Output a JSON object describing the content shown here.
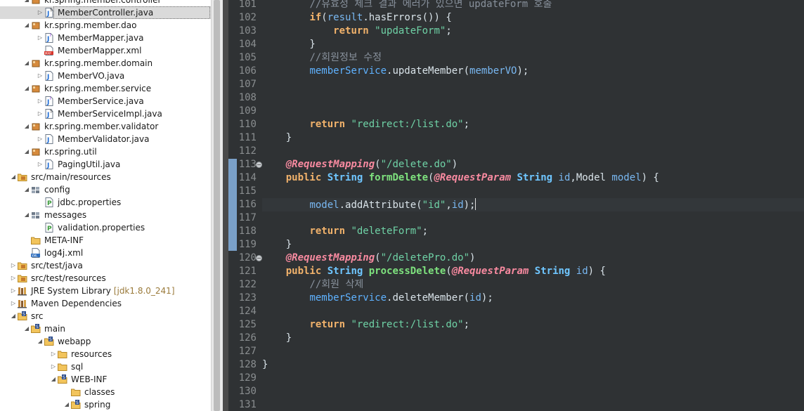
{
  "explorer": {
    "items": [
      {
        "label": "kr.spring.member.controller",
        "icon": "package-icon",
        "twisty": "expanded",
        "indent": 2,
        "selected": false
      },
      {
        "label": "MemberController.java",
        "icon": "java-class-icon",
        "twisty": "collapsed",
        "indent": 3,
        "selected": true
      },
      {
        "label": "kr.spring.member.dao",
        "icon": "package-icon",
        "twisty": "expanded",
        "indent": 2,
        "selected": false
      },
      {
        "label": "MemberMapper.java",
        "icon": "java-interface-icon",
        "twisty": "collapsed",
        "indent": 3,
        "selected": false
      },
      {
        "label": "MemberMapper.xml",
        "icon": "mybatis-xml-icon",
        "twisty": "none",
        "indent": 3,
        "selected": false
      },
      {
        "label": "kr.spring.member.domain",
        "icon": "package-icon",
        "twisty": "expanded",
        "indent": 2,
        "selected": false
      },
      {
        "label": "MemberVO.java",
        "icon": "java-file-icon",
        "twisty": "collapsed",
        "indent": 3,
        "selected": false
      },
      {
        "label": "kr.spring.member.service",
        "icon": "package-icon",
        "twisty": "expanded",
        "indent": 2,
        "selected": false
      },
      {
        "label": "MemberService.java",
        "icon": "java-interface-icon",
        "twisty": "collapsed",
        "indent": 3,
        "selected": false
      },
      {
        "label": "MemberServiceImpl.java",
        "icon": "java-class-icon",
        "twisty": "collapsed",
        "indent": 3,
        "selected": false
      },
      {
        "label": "kr.spring.member.validator",
        "icon": "package-icon",
        "twisty": "expanded",
        "indent": 2,
        "selected": false
      },
      {
        "label": "MemberValidator.java",
        "icon": "java-file-icon",
        "twisty": "collapsed",
        "indent": 3,
        "selected": false
      },
      {
        "label": "kr.spring.util",
        "icon": "package-icon",
        "twisty": "expanded",
        "indent": 2,
        "selected": false
      },
      {
        "label": "PagingUtil.java",
        "icon": "java-file-icon",
        "twisty": "collapsed",
        "indent": 3,
        "selected": false
      },
      {
        "label": "src/main/resources",
        "icon": "source-folder-icon",
        "twisty": "expanded",
        "indent": 1,
        "selected": false
      },
      {
        "label": "config",
        "icon": "resource-package-icon",
        "twisty": "expanded",
        "indent": 2,
        "selected": false
      },
      {
        "label": "jdbc.properties",
        "icon": "properties-file-icon",
        "twisty": "none",
        "indent": 3,
        "selected": false
      },
      {
        "label": "messages",
        "icon": "resource-package-icon",
        "twisty": "expanded",
        "indent": 2,
        "selected": false
      },
      {
        "label": "validation.properties",
        "icon": "properties-file-icon",
        "twisty": "none",
        "indent": 3,
        "selected": false
      },
      {
        "label": "META-INF",
        "icon": "folder-icon",
        "twisty": "none",
        "indent": 2,
        "selected": false
      },
      {
        "label": "log4j.xml",
        "icon": "xml-file-icon",
        "twisty": "none",
        "indent": 2,
        "selected": false
      },
      {
        "label": "src/test/java",
        "icon": "source-folder-icon",
        "twisty": "collapsed",
        "indent": 1,
        "selected": false
      },
      {
        "label": "src/test/resources",
        "icon": "source-folder-icon",
        "twisty": "collapsed",
        "indent": 1,
        "selected": false
      },
      {
        "label": "JRE System Library",
        "suffix": "[jdk1.8.0_241]",
        "icon": "library-icon",
        "twisty": "collapsed",
        "indent": 1,
        "selected": false
      },
      {
        "label": "Maven Dependencies",
        "icon": "library-icon",
        "twisty": "collapsed",
        "indent": 1,
        "selected": false
      },
      {
        "label": "src",
        "icon": "vcs-folder-icon",
        "twisty": "expanded",
        "indent": 1,
        "selected": false
      },
      {
        "label": "main",
        "icon": "vcs-folder-icon",
        "twisty": "expanded",
        "indent": 2,
        "selected": false
      },
      {
        "label": "webapp",
        "icon": "vcs-folder-icon",
        "twisty": "expanded",
        "indent": 3,
        "selected": false
      },
      {
        "label": "resources",
        "icon": "folder-icon",
        "twisty": "collapsed",
        "indent": 4,
        "selected": false
      },
      {
        "label": "sql",
        "icon": "folder-icon",
        "twisty": "collapsed",
        "indent": 4,
        "selected": false
      },
      {
        "label": "WEB-INF",
        "icon": "vcs-folder-icon",
        "twisty": "expanded",
        "indent": 4,
        "selected": false
      },
      {
        "label": "classes",
        "icon": "folder-icon",
        "twisty": "none",
        "indent": 5,
        "selected": false
      },
      {
        "label": "spring",
        "icon": "vcs-folder-icon",
        "twisty": "expanded",
        "indent": 5,
        "selected": false
      }
    ]
  },
  "editor": {
    "current_line": "116",
    "lines": [
      {
        "no": "101",
        "tokens": [
          [
            "pl",
            "        "
          ],
          [
            "cm",
            "//유효성 체크 결과 에러가 있으면 updateForm 호출"
          ]
        ]
      },
      {
        "no": "102",
        "tokens": [
          [
            "pl",
            "        "
          ],
          [
            "kw",
            "if"
          ],
          [
            "pl",
            "("
          ],
          [
            "var",
            "result"
          ],
          [
            "pl",
            "."
          ],
          [
            "pl",
            "hasErrors"
          ],
          [
            "pl",
            "()) {"
          ]
        ]
      },
      {
        "no": "103",
        "tokens": [
          [
            "pl",
            "            "
          ],
          [
            "kw",
            "return"
          ],
          [
            "pl",
            " "
          ],
          [
            "str",
            "\"updateForm\""
          ],
          [
            "pl",
            ";"
          ]
        ]
      },
      {
        "no": "104",
        "tokens": [
          [
            "pl",
            "        }"
          ]
        ]
      },
      {
        "no": "105",
        "tokens": [
          [
            "pl",
            "        "
          ],
          [
            "cm",
            "//회원정보 수정"
          ]
        ]
      },
      {
        "no": "106",
        "tokens": [
          [
            "pl",
            "        "
          ],
          [
            "fld",
            "memberService"
          ],
          [
            "pl",
            "."
          ],
          [
            "pl",
            "updateMember("
          ],
          [
            "var",
            "memberVO"
          ],
          [
            "pl",
            ");"
          ]
        ]
      },
      {
        "no": "107",
        "tokens": []
      },
      {
        "no": "108",
        "tokens": []
      },
      {
        "no": "109",
        "tokens": []
      },
      {
        "no": "110",
        "tokens": [
          [
            "pl",
            "        "
          ],
          [
            "kw",
            "return"
          ],
          [
            "pl",
            " "
          ],
          [
            "str",
            "\"redirect:/list.do\""
          ],
          [
            "pl",
            ";"
          ]
        ]
      },
      {
        "no": "111",
        "tokens": [
          [
            "pl",
            "    }"
          ]
        ]
      },
      {
        "no": "112",
        "tokens": []
      },
      {
        "no": "113",
        "fold": true,
        "tokens": [
          [
            "pl",
            "    "
          ],
          [
            "ann",
            "@RequestMapping"
          ],
          [
            "pl",
            "("
          ],
          [
            "str",
            "\"/delete.do\""
          ],
          [
            "pl",
            ")"
          ]
        ]
      },
      {
        "no": "114",
        "tokens": [
          [
            "pl",
            "    "
          ],
          [
            "kw",
            "public"
          ],
          [
            "pl",
            " "
          ],
          [
            "ty",
            "String"
          ],
          [
            "pl",
            " "
          ],
          [
            "fn",
            "formDelete"
          ],
          [
            "pl",
            "("
          ],
          [
            "ann",
            "@RequestParam"
          ],
          [
            "pl",
            " "
          ],
          [
            "ty",
            "String"
          ],
          [
            "pl",
            " "
          ],
          [
            "var",
            "id"
          ],
          [
            "pl",
            ","
          ],
          [
            "pl",
            "Model"
          ],
          [
            "pl",
            " "
          ],
          [
            "var",
            "model"
          ],
          [
            "pl",
            ") {"
          ]
        ]
      },
      {
        "no": "115",
        "tokens": []
      },
      {
        "no": "116",
        "tokens": [
          [
            "pl",
            "        "
          ],
          [
            "var",
            "model"
          ],
          [
            "pl",
            "."
          ],
          [
            "pl",
            "addAttribute("
          ],
          [
            "str",
            "\"id\""
          ],
          [
            "pl",
            ","
          ],
          [
            "var",
            "id"
          ],
          [
            "pl",
            ");"
          ]
        ],
        "caret": true
      },
      {
        "no": "117",
        "tokens": []
      },
      {
        "no": "118",
        "tokens": [
          [
            "pl",
            "        "
          ],
          [
            "kw",
            "return"
          ],
          [
            "pl",
            " "
          ],
          [
            "str",
            "\"deleteForm\""
          ],
          [
            "pl",
            ";"
          ]
        ]
      },
      {
        "no": "119",
        "tokens": [
          [
            "pl",
            "    }"
          ]
        ]
      },
      {
        "no": "120",
        "fold": true,
        "tokens": [
          [
            "pl",
            "    "
          ],
          [
            "ann",
            "@RequestMapping"
          ],
          [
            "pl",
            "("
          ],
          [
            "str",
            "\"/deletePro.do\""
          ],
          [
            "pl",
            ")"
          ]
        ]
      },
      {
        "no": "121",
        "tokens": [
          [
            "pl",
            "    "
          ],
          [
            "kw",
            "public"
          ],
          [
            "pl",
            " "
          ],
          [
            "ty",
            "String"
          ],
          [
            "pl",
            " "
          ],
          [
            "fn",
            "processDelete"
          ],
          [
            "pl",
            "("
          ],
          [
            "ann",
            "@RequestParam"
          ],
          [
            "pl",
            " "
          ],
          [
            "ty",
            "String"
          ],
          [
            "pl",
            " "
          ],
          [
            "var",
            "id"
          ],
          [
            "pl",
            ") {"
          ]
        ]
      },
      {
        "no": "122",
        "tokens": [
          [
            "pl",
            "        "
          ],
          [
            "cm",
            "//회원 삭제"
          ]
        ]
      },
      {
        "no": "123",
        "tokens": [
          [
            "pl",
            "        "
          ],
          [
            "fld",
            "memberService"
          ],
          [
            "pl",
            "."
          ],
          [
            "pl",
            "deleteMember("
          ],
          [
            "var",
            "id"
          ],
          [
            "pl",
            ");"
          ]
        ]
      },
      {
        "no": "124",
        "tokens": []
      },
      {
        "no": "125",
        "tokens": [
          [
            "pl",
            "        "
          ],
          [
            "kw",
            "return"
          ],
          [
            "pl",
            " "
          ],
          [
            "str",
            "\"redirect:/list.do\""
          ],
          [
            "pl",
            ";"
          ]
        ]
      },
      {
        "no": "126",
        "tokens": [
          [
            "pl",
            "    }"
          ]
        ]
      },
      {
        "no": "127",
        "tokens": []
      },
      {
        "no": "128",
        "tokens": [
          [
            "pl",
            "}"
          ]
        ]
      },
      {
        "no": "129",
        "tokens": []
      },
      {
        "no": "130",
        "tokens": []
      },
      {
        "no": "131",
        "tokens": []
      }
    ]
  },
  "colors": {
    "editor_bg": "#2f3234",
    "keyword": "#f1b26b",
    "string": "#6fd2a6",
    "annotation": "#f88aa0",
    "type": "#6fc6ff",
    "method_decl": "#7ee27e",
    "comment": "#88919c",
    "selection": "#5f82a6"
  }
}
